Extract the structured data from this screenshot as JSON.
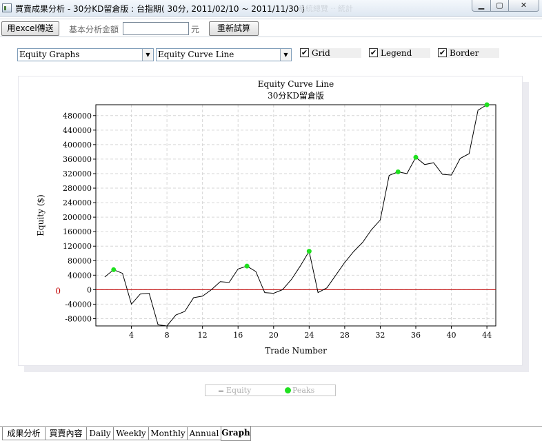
{
  "window": {
    "title": "買賣成果分析 - 30分KD留倉版 : 台指期( 30分, 2011/02/10 ~ 2011/11/30 )",
    "ghost_text": "系統總覽 ·· 統計",
    "min_symbol": "▁",
    "max_symbol": "▢",
    "close_symbol": "✕"
  },
  "toolbar": {
    "excel_label": "用excel傳送",
    "amount_label": "基本分析金額",
    "amount_value": "",
    "amount_unit": "元",
    "recalc_label": "重新試算"
  },
  "controls": {
    "graph_type": "Equity Graphs",
    "graph_style": "Equity Curve Line",
    "dropdown_arrow": "▼",
    "checkmark": "✔",
    "grid": {
      "label": "Grid",
      "checked": true
    },
    "legend": {
      "label": "Legend",
      "checked": true
    },
    "border": {
      "label": "Border",
      "checked": true
    }
  },
  "chart_data": {
    "type": "line",
    "title": "Equity Curve Line",
    "subtitle": "30分KD留倉版",
    "xlabel": "Trade Number",
    "ylabel": "Equity ($)",
    "zero_label": "0",
    "xlim": [
      0,
      45
    ],
    "ylim": [
      -100000,
      510000
    ],
    "xticks": [
      4,
      8,
      12,
      16,
      20,
      24,
      28,
      32,
      36,
      40,
      44
    ],
    "yticks": [
      -80000,
      -40000,
      0,
      40000,
      80000,
      120000,
      160000,
      200000,
      240000,
      280000,
      320000,
      360000,
      400000,
      440000,
      480000
    ],
    "grid": true,
    "legend_position": "bottom",
    "series": [
      {
        "name": "Equity",
        "color": "#000000",
        "x": [
          1,
          2,
          3,
          4,
          5,
          6,
          7,
          8,
          9,
          10,
          11,
          12,
          13,
          14,
          15,
          16,
          17,
          18,
          19,
          20,
          21,
          22,
          23,
          24,
          25,
          26,
          27,
          28,
          29,
          30,
          31,
          32,
          33,
          34,
          35,
          36,
          37,
          38,
          39,
          40,
          41,
          42,
          43,
          44
        ],
        "values": [
          35000,
          55000,
          45000,
          -40000,
          -12000,
          -10000,
          -97000,
          -100000,
          -70000,
          -60000,
          -22000,
          -18000,
          0,
          22000,
          20000,
          57000,
          65000,
          50000,
          -8000,
          -10000,
          0,
          28000,
          65000,
          106000,
          -8000,
          5000,
          40000,
          75000,
          105000,
          130000,
          165000,
          192000,
          315000,
          325000,
          320000,
          365000,
          345000,
          350000,
          318000,
          316000,
          362000,
          375000,
          495000,
          510000
        ]
      },
      {
        "name": "Peaks",
        "color": "#1fe01f",
        "x": [
          2,
          17,
          24,
          34,
          36,
          44
        ],
        "values": [
          55000,
          65000,
          106000,
          325000,
          365000,
          510000
        ]
      }
    ],
    "zero_line_color": "#c00000"
  },
  "tabs": [
    {
      "label": "成果分析",
      "active": false
    },
    {
      "label": "買賣內容",
      "active": false
    },
    {
      "label": "Daily",
      "active": false
    },
    {
      "label": "Weekly",
      "active": false
    },
    {
      "label": "Monthly",
      "active": false
    },
    {
      "label": "Annual",
      "active": false
    },
    {
      "label": "Graph",
      "active": true
    }
  ]
}
